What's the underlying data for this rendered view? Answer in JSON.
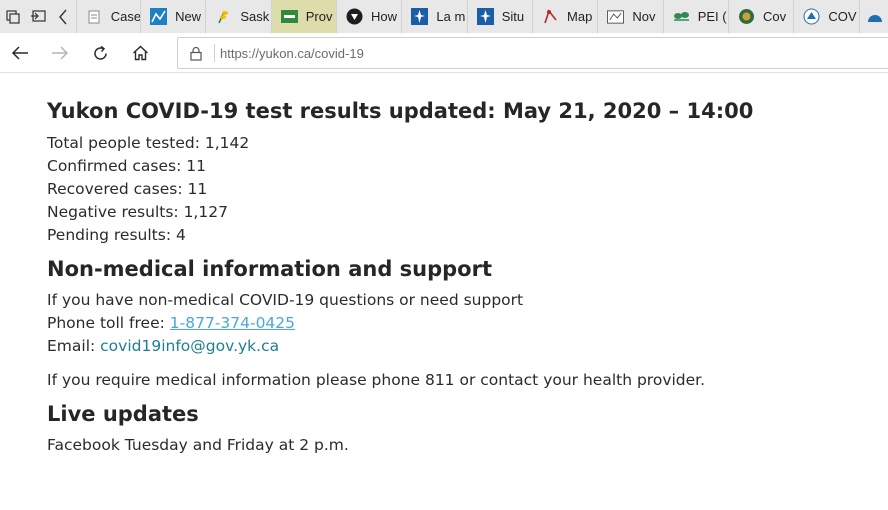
{
  "browser": {
    "tabs": [
      {
        "label": "Case",
        "icon": "grey-doc-icon",
        "active": false
      },
      {
        "label": "New",
        "icon": "chart-icon",
        "active": false
      },
      {
        "label": "Sask",
        "icon": "saskatchewan-wheat-icon",
        "active": false
      },
      {
        "label": "Prov",
        "icon": "green-flag-icon",
        "active": true
      },
      {
        "label": "How",
        "icon": "shield-icon",
        "active": false
      },
      {
        "label": "La m",
        "icon": "quebec-fleur-de-lis-icon",
        "active": false
      },
      {
        "label": "Situ",
        "icon": "quebec-fleur-de-lis-icon",
        "active": false
      },
      {
        "label": "Map",
        "icon": "map-pin-icon",
        "active": false
      },
      {
        "label": "Nov",
        "icon": "news-icon",
        "active": false
      },
      {
        "label": "PEI (",
        "icon": "pei-tree-icon",
        "active": false
      },
      {
        "label": "Cov",
        "icon": "globe-icon",
        "active": false
      },
      {
        "label": "COV",
        "icon": "government-icon",
        "active": false
      }
    ],
    "url": "https://yukon.ca/covid-19"
  },
  "page": {
    "headline": "Yukon COVID-19 test results updated: May 21, 2020 – 14:00",
    "stats": [
      "Total people tested: 1,142",
      "Confirmed cases: 11",
      "Recovered cases: 11",
      "Negative results: 1,127",
      "Pending results: 4"
    ],
    "support": {
      "heading": "Non-medical information and support",
      "intro": "If you have non-medical COVID-19 questions or need support",
      "phone_label": "Phone toll free: ",
      "phone": "1-877-374-0425",
      "email_label": "Email: ",
      "email": "covid19info@gov.yk.ca",
      "medical_note": "If you require medical information please phone 811 or contact your health provider."
    },
    "live": {
      "heading": "Live updates",
      "text": "Facebook Tuesday and Friday at 2 p.m."
    }
  },
  "colors": {
    "active_tab": "#dddcab",
    "phone_link": "#49a7dc",
    "email_link": "#1e7f93"
  }
}
